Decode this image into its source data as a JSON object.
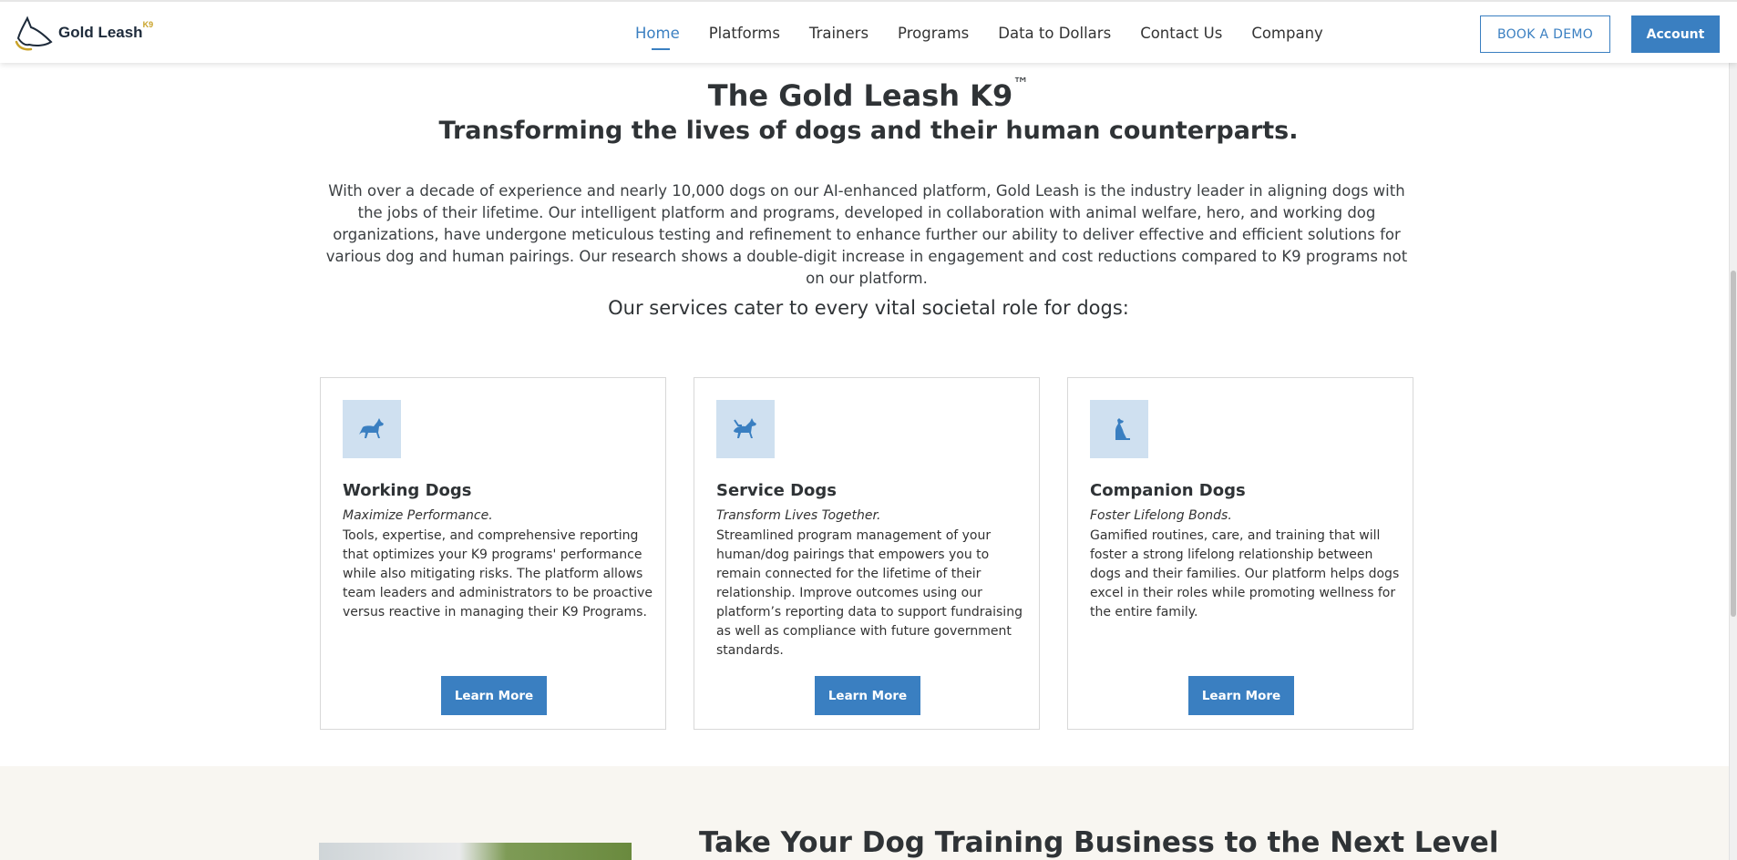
{
  "header": {
    "logo_text": "Gold Leash",
    "logo_sup": "K9",
    "nav": [
      {
        "label": "Home",
        "active": true
      },
      {
        "label": "Platforms"
      },
      {
        "label": "Trainers"
      },
      {
        "label": "Programs"
      },
      {
        "label": "Data to Dollars"
      },
      {
        "label": "Contact Us"
      },
      {
        "label": "Company"
      }
    ],
    "book_demo": "BOOK A DEMO",
    "account": "Account"
  },
  "hero": {
    "title": "The Gold Leash K9",
    "title_mark": "™",
    "subtitle": "Transforming the lives of dogs and their human counterparts.",
    "intro": "With over a decade of experience and nearly 10,000 dogs on our AI-enhanced platform, Gold Leash is the industry leader in aligning dogs with the jobs of their lifetime. Our intelligent platform and programs, developed in collaboration with animal welfare, hero, and working dog organizations, have undergone meticulous testing and refinement to enhance further our ability to deliver effective and efficient solutions for various dog and human pairings. Our research shows a double-digit increase in engagement and cost reductions compared to K9 programs not on our platform.",
    "services_line": "Our services cater to every vital societal role for dogs:"
  },
  "cards": [
    {
      "icon": "working-dog-icon",
      "title": "Working Dogs",
      "tagline": "Maximize Performance.",
      "body": "Tools, expertise, and comprehensive reporting that optimizes your K9 programs' performance while also mitigating risks. The platform allows team leaders and administrators to be proactive versus reactive in managing their K9 Programs.",
      "button": "Learn More"
    },
    {
      "icon": "service-dog-icon",
      "title": "Service Dogs",
      "tagline": "Transform Lives Together.",
      "body": "Streamlined program management of your human/dog pairings that empowers you to remain connected for the lifetime of their relationship. Improve outcomes using our platform’s reporting data to support fundraising as well as compliance with future government standards.",
      "button": "Learn More"
    },
    {
      "icon": "companion-dog-icon",
      "title": "Companion Dogs",
      "tagline": "Foster Lifelong Bonds.",
      "body": "Gamified routines, care, and training that will foster a strong lifelong relationship between dogs and their families. Our platform helps dogs excel in their roles while promoting wellness for the entire family.",
      "button": "Learn More"
    }
  ],
  "band": {
    "title": "Take Your Dog Training Business to the Next Level"
  },
  "colors": {
    "accent": "#3a7fc1",
    "icon_bg": "#cfe0f0",
    "band_bg": "#f8f6f1",
    "logo_gold": "#c9a227"
  }
}
